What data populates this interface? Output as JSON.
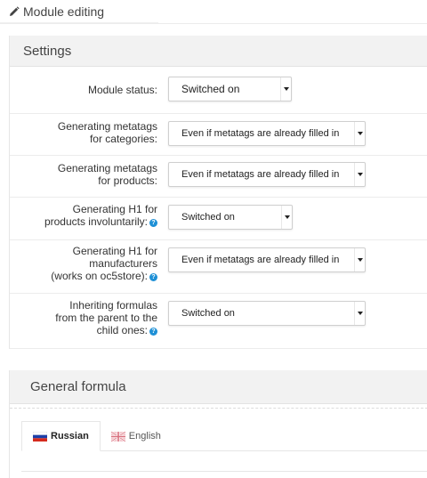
{
  "header": {
    "title": "Module editing",
    "icon": "pencil-icon"
  },
  "settings": {
    "heading": "Settings",
    "rows": [
      {
        "label_lines": [
          "Module status:"
        ],
        "value": "Switched on",
        "help": false
      },
      {
        "label_lines": [
          "Generating metatags",
          "for categories:"
        ],
        "value": "Even if metatags are already filled in",
        "help": false
      },
      {
        "label_lines": [
          "Generating metatags",
          "for products:"
        ],
        "value": "Even if metatags are already filled in",
        "help": false
      },
      {
        "label_lines": [
          "Generating H1 for",
          "products involuntarily:"
        ],
        "value": "Switched on",
        "help": true
      },
      {
        "label_lines": [
          "Generating H1 for",
          "manufacturers",
          "(works on oc5store):"
        ],
        "value": "Even if metatags are already filled in",
        "help": true
      },
      {
        "label_lines": [
          "Inheriting formulas",
          "from the parent to the",
          "child ones:"
        ],
        "value": "Switched on",
        "help": true
      }
    ]
  },
  "formula": {
    "heading": "General formula",
    "tabs": [
      {
        "label": "Russian",
        "active": true,
        "flag": "russia-flag-icon"
      },
      {
        "label": "English",
        "active": false,
        "flag": "uk-flag-icon"
      }
    ]
  },
  "colors": {
    "help": "#1e90d6",
    "panel_heading_bg": "#f2f2f2"
  }
}
